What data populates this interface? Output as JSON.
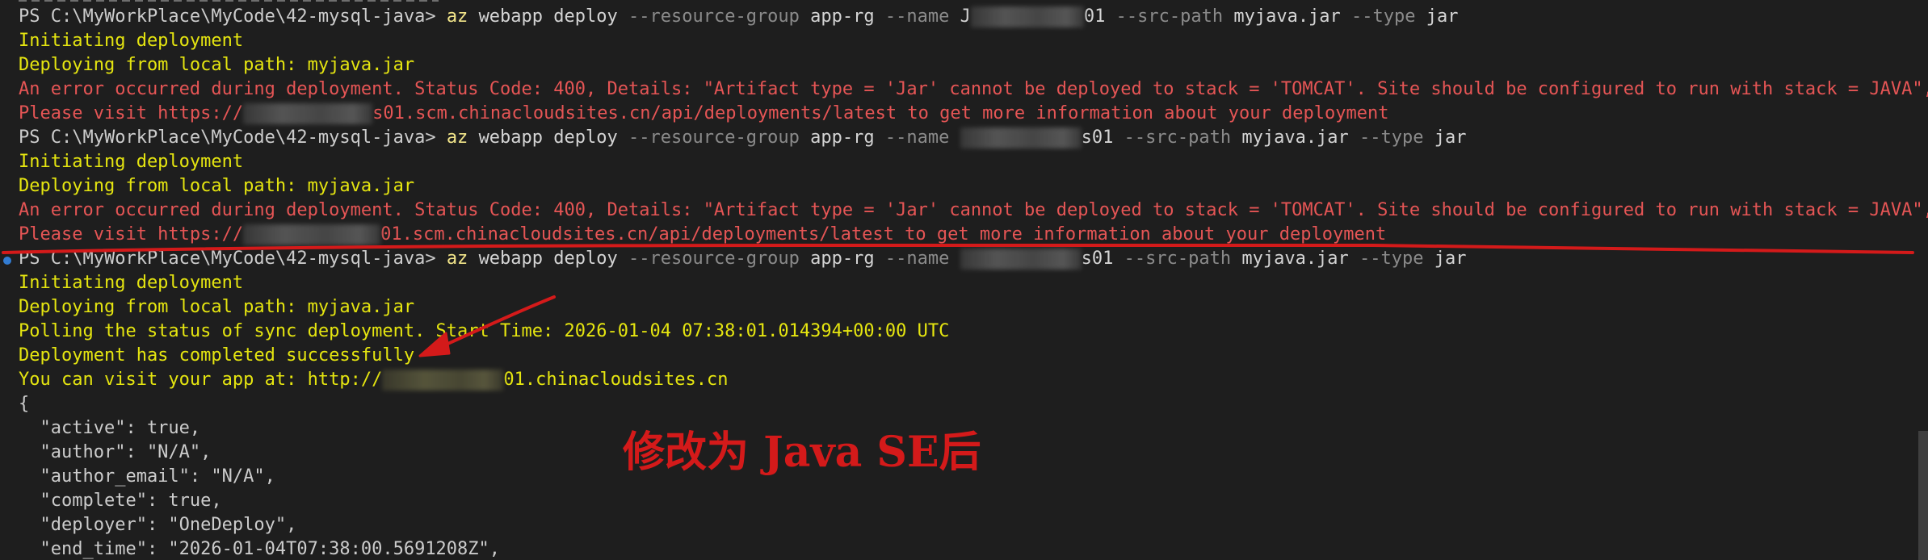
{
  "terminal": {
    "lines": [
      {
        "type": "cmd",
        "prompt": "PS C:\\MyWorkPlace\\MyCode\\42-mysql-java>",
        "command": "az",
        "sub": "webapp deploy",
        "p1": "--resource-group",
        "v1": "app-rg",
        "p2": "--name",
        "name_prefix": "J",
        "name_suffix": "01",
        "p3": "--src-path",
        "v3": "myjava.jar",
        "p4": "--type",
        "v4": "jar"
      },
      {
        "type": "yellow",
        "text": "Initiating deployment"
      },
      {
        "type": "yellow",
        "text": "Deploying from local path: myjava.jar"
      },
      {
        "type": "red",
        "text": "An error occurred during deployment. Status Code: 400, Details: \"Artifact type = 'Jar' cannot be deployed to stack = 'TOMCAT'. Site should be configured to run with stack = JAVA\","
      },
      {
        "type": "url",
        "prefix": "Please visit https://",
        "suffix": "s01.scm.chinacloudsites.cn/api/deployments/latest to get more information about your deployment"
      },
      {
        "type": "cmd",
        "prompt": "PS C:\\MyWorkPlace\\MyCode\\42-mysql-java>",
        "command": "az",
        "sub": "webapp deploy",
        "p1": "--resource-group",
        "v1": "app-rg",
        "p2": "--name",
        "name_prefix": "",
        "name_suffix": "s01",
        "p3": "--src-path",
        "v3": "myjava.jar",
        "p4": "--type",
        "v4": "jar"
      },
      {
        "type": "yellow",
        "text": "Initiating deployment"
      },
      {
        "type": "yellow",
        "text": "Deploying from local path: myjava.jar"
      },
      {
        "type": "red",
        "text": "An error occurred during deployment. Status Code: 400, Details: \"Artifact type = 'Jar' cannot be deployed to stack = 'TOMCAT'. Site should be configured to run with stack = JAVA\","
      },
      {
        "type": "url",
        "prefix": "Please visit https://",
        "suffix": "01.scm.chinacloudsites.cn/api/deployments/latest to get more information about your deployment"
      },
      {
        "type": "cmd",
        "prompt": "PS C:\\MyWorkPlace\\MyCode\\42-mysql-java>",
        "command": "az",
        "sub": "webapp deploy",
        "p1": "--resource-group",
        "v1": "app-rg",
        "p2": "--name",
        "name_prefix": "",
        "name_suffix": "s01",
        "p3": "--src-path",
        "v3": "myjava.jar",
        "p4": "--type",
        "v4": "jar"
      },
      {
        "type": "yellow",
        "text": "Initiating deployment"
      },
      {
        "type": "yellow",
        "text": "Deploying from local path: myjava.jar"
      },
      {
        "type": "yellow",
        "text": "Polling the status of sync deployment. Start Time: 2026-01-04 07:38:01.014394+00:00 UTC"
      },
      {
        "type": "yellow",
        "text": "Deployment has completed successfully"
      },
      {
        "type": "visit",
        "prefix": "You can visit your app at: http://",
        "suffix": "01.chinacloudsites.cn"
      },
      {
        "type": "json",
        "text": "{"
      },
      {
        "type": "json",
        "text": "  \"active\": true,"
      },
      {
        "type": "json",
        "text": "  \"author\": \"N/A\","
      },
      {
        "type": "json",
        "text": "  \"author_email\": \"N/A\","
      },
      {
        "type": "json",
        "text": "  \"complete\": true,"
      },
      {
        "type": "json",
        "text": "  \"deployer\": \"OneDeploy\","
      },
      {
        "type": "json",
        "text": "  \"end_time\": \"2026-01-04T07:38:00.5691208Z\","
      }
    ]
  },
  "annotation": {
    "text": "修改为 Java SE后",
    "color": "#d41a1a"
  },
  "colors": {
    "background": "#1e1e1e",
    "yellow_output": "#e5e510",
    "error_red": "#e55555",
    "command": "#f2e58a",
    "parameter_gray": "#8a8a8a",
    "scroll_marker": "#3794ff"
  }
}
